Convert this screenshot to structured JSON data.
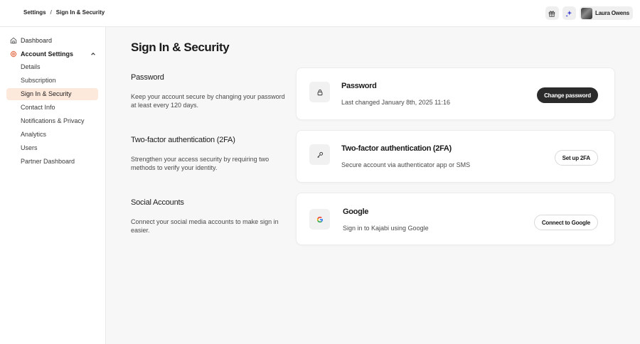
{
  "breadcrumb": {
    "parent": "Settings",
    "separator": "/",
    "current": "Sign In & Security"
  },
  "header": {
    "user_name": "Laura Owens",
    "icons": [
      "gift-icon",
      "sparkle-icon"
    ]
  },
  "sidebar": {
    "dashboard_label": "Dashboard",
    "account_settings_label": "Account Settings",
    "items": [
      {
        "label": "Details"
      },
      {
        "label": "Subscription"
      },
      {
        "label": "Sign In & Security",
        "active": true
      },
      {
        "label": "Contact Info"
      },
      {
        "label": "Notifications & Privacy"
      },
      {
        "label": "Analytics"
      },
      {
        "label": "Users"
      },
      {
        "label": "Partner Dashboard"
      }
    ]
  },
  "main": {
    "title": "Sign In & Security",
    "sections": [
      {
        "title": "Password",
        "description": "Keep your account secure by changing your password at least every 120 days.",
        "card": {
          "icon": "lock-icon",
          "title": "Password",
          "subtitle": "Last changed January 8th, 2025 11:16",
          "button": "Change password"
        }
      },
      {
        "title": "Two-factor authentication (2FA)",
        "description": "Strengthen your access security by requiring two methods to verify your identity.",
        "card": {
          "icon": "key-icon",
          "title": "Two-factor authentication (2FA)",
          "subtitle": "Secure account via authenticator app or SMS",
          "button": "Set up 2FA"
        }
      },
      {
        "title": "Social Accounts",
        "description": "Connect your social media accounts to make sign in easier.",
        "card": {
          "icon": "google-icon",
          "title": "Google",
          "subtitle": "Sign in to Kajabi using Google",
          "button": "Connect to Google"
        }
      }
    ]
  },
  "colors": {
    "accent": "#e0603a",
    "active_bg": "#fde8dc",
    "dark_button": "#2b2b2b"
  }
}
